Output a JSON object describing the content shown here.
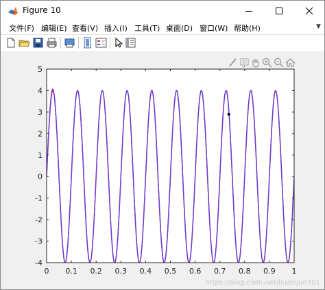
{
  "window": {
    "title": "Figure 10"
  },
  "menu": {
    "items": [
      "文件(F)",
      "编辑(E)",
      "查看(V)",
      "插入(I)",
      "工具(T)",
      "桌面(D)",
      "窗口(W)",
      "帮助(H)"
    ]
  },
  "toolbar": {
    "icons": [
      "new-figure-icon",
      "open-file-icon",
      "save-icon",
      "print-icon",
      "print-preview-icon",
      "link-plot-icon",
      "insert-legend-icon",
      "pointer-icon",
      "property-inspector-icon"
    ]
  },
  "axes_toolbar": {
    "icons": [
      "brush-icon",
      "data-tip-icon",
      "pan-icon",
      "zoom-in-icon",
      "zoom-out-icon",
      "home-icon"
    ]
  },
  "colors": {
    "background": "#f0f0f0",
    "axes": "#ffffff",
    "series_1": "#ff0000",
    "series_2": "#5f3fdc",
    "marker": "#000000"
  },
  "chart_data": {
    "type": "line",
    "title": "",
    "xlabel": "",
    "ylabel": "",
    "xlim": [
      0,
      1
    ],
    "ylim": [
      -4,
      5
    ],
    "xticks": [
      0,
      0.1,
      0.2,
      0.3,
      0.4,
      0.5,
      0.6,
      0.7,
      0.8,
      0.9,
      1
    ],
    "xtick_labels": [
      "0",
      "0.1",
      "0.2",
      "0.3",
      "0.4",
      "0.5",
      "0.6",
      "0.7",
      "0.8",
      "0.9",
      "1"
    ],
    "yticks": [
      -4,
      -3,
      -2,
      -1,
      0,
      1,
      2,
      3,
      4,
      5
    ],
    "ytick_labels": [
      "-4",
      "-3",
      "-2",
      "-1",
      "0",
      "1",
      "2",
      "3",
      "4",
      "5"
    ],
    "grid": false,
    "series": [
      {
        "style": "red line",
        "function": "4*cos(2*pi*10*(x-0.025))",
        "x_range": [
          0,
          1
        ]
      },
      {
        "style": "purple line",
        "function": "4*cos(2*pi*10*(x-0.025)) + 0.25*exp(-x/0.02)*sin(2*pi*10*x)",
        "x_range": [
          0,
          1
        ]
      }
    ],
    "points": [
      {
        "x": 0.736,
        "y": 2.9
      }
    ]
  },
  "watermark": "https://blog.csdn.net/liuzhijun301"
}
